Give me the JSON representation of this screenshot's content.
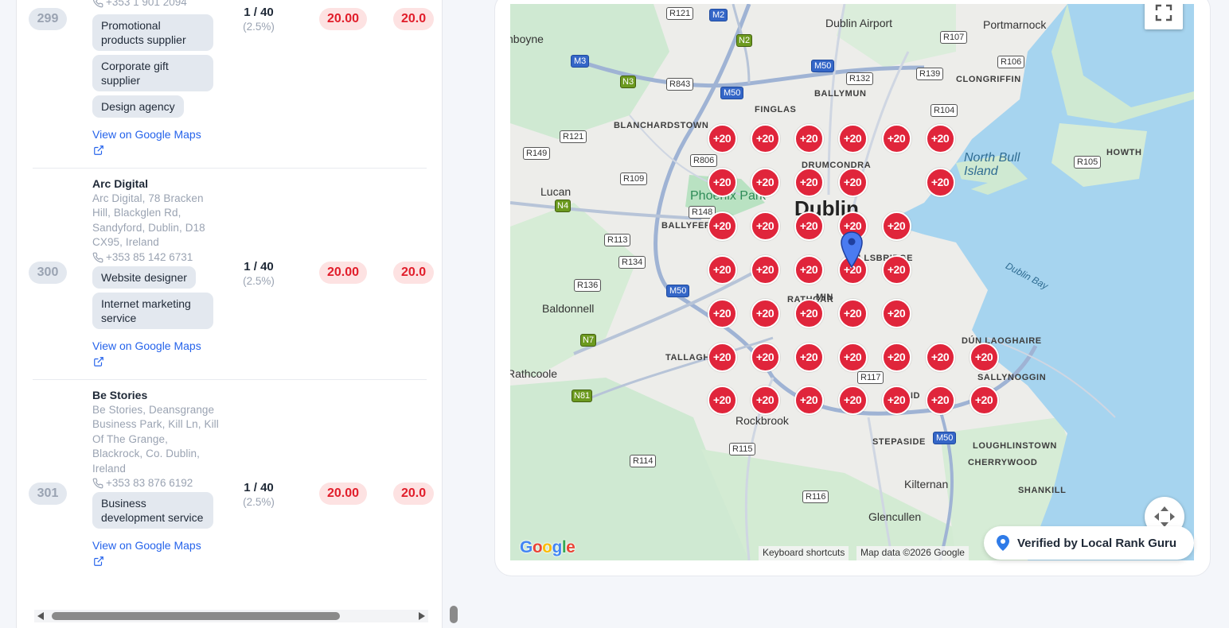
{
  "rows": [
    {
      "rank": "299",
      "phone": "+353 1 901 2094",
      "tags": [
        "Promotional products supplier",
        "Corporate gift supplier",
        "Design agency"
      ],
      "link": "View on Google Maps",
      "score": "1 / 40",
      "percent": "(2.5%)",
      "value1": "20.00",
      "value2": "20.0"
    },
    {
      "rank": "300",
      "name": "Arc Digital",
      "address": "Arc Digital, 78 Bracken Hill, Blackglen Rd, Sandyford, Dublin, D18 CX95, Ireland",
      "phone": "+353 85 142 6731",
      "tags": [
        "Website designer",
        "Internet marketing service"
      ],
      "link": "View on Google Maps",
      "score": "1 / 40",
      "percent": "(2.5%)",
      "value1": "20.00",
      "value2": "20.0"
    },
    {
      "rank": "301",
      "name": "Be Stories",
      "address": "Be Stories, Deansgrange Business Park, Kill Ln, Kill Of The Grange, Blackrock, Co. Dublin, Ireland",
      "phone": "+353 83 876 6192",
      "tags": [
        "Business development service"
      ],
      "link": "View on Google Maps",
      "score": "1 / 40",
      "percent": "(2.5%)",
      "value1": "20.00",
      "value2": "20.0"
    }
  ],
  "map": {
    "marker_label": "+20",
    "marker_color": "#e0253b",
    "pin_color": "#4a7bf0",
    "places": {
      "dublin": "Dublin",
      "dublin_airport": "Dublin Airport",
      "portmarnock": "Portmarnock",
      "clongriffin": "CLONGRIFFIN",
      "ballymun": "BALLYMUN",
      "finglas": "FINGLAS",
      "blanchardstown": "BLANCHARDSTOWN",
      "drumcondra": "DRUMCONDRA",
      "howth": "HOWTH",
      "north_bull_island": "North Bull\nIsland",
      "phoenix_park": "Phoenix Park",
      "lucan": "Lucan",
      "ballyfermot": "BALLYFER",
      "ballsbridge": "BALLSBRIDGE",
      "rathgar": "RATHGAR",
      "dublin_bay": "Dublin Bay",
      "baldonnell": "Baldonnell",
      "tallaght": "TALLAGH",
      "dun_laoghaire": "DÚN LAOGHAIRE",
      "sallynoggin": "SALLYNOGGIN",
      "rathcoole": "Rathcoole",
      "rockbrook": "Rockbrook",
      "stepaside": "STEPASIDE",
      "loughlinstown": "LOUGHLINSTOWN",
      "cherrywood": "CHERRYWOOD",
      "kilternan": "Kilternan",
      "shankill": "SHANKILL",
      "glencullen": "Glencullen",
      "boyne": "nboyne",
      "ranelagh": "MIN",
      "sandyford": "ND"
    },
    "roads": {
      "R121a": "R121",
      "M2": "M2",
      "N2": "N2",
      "R107": "R107",
      "M3": "M3",
      "N3": "N3",
      "R843": "R843",
      "M50a": "M50",
      "R132": "R132",
      "R139": "R139",
      "R106": "R106",
      "M50b": "M50",
      "R104": "R104",
      "R121b": "R121",
      "R149": "R149",
      "R806": "R806",
      "R109": "R109",
      "R105": "R105",
      "N4": "N4",
      "R148": "R148",
      "R113": "R113",
      "R134": "R134",
      "R136": "R136",
      "M50c": "M50",
      "N7": "N7",
      "R117": "R117",
      "N81": "N81",
      "R115": "R115",
      "R114": "R114",
      "M50d": "M50",
      "R116": "R116"
    },
    "google": "Google",
    "keyboard_shortcuts": "Keyboard shortcuts",
    "map_data": "Map data ©2026 Google"
  },
  "verified_label": "Verified by Local Rank Guru"
}
